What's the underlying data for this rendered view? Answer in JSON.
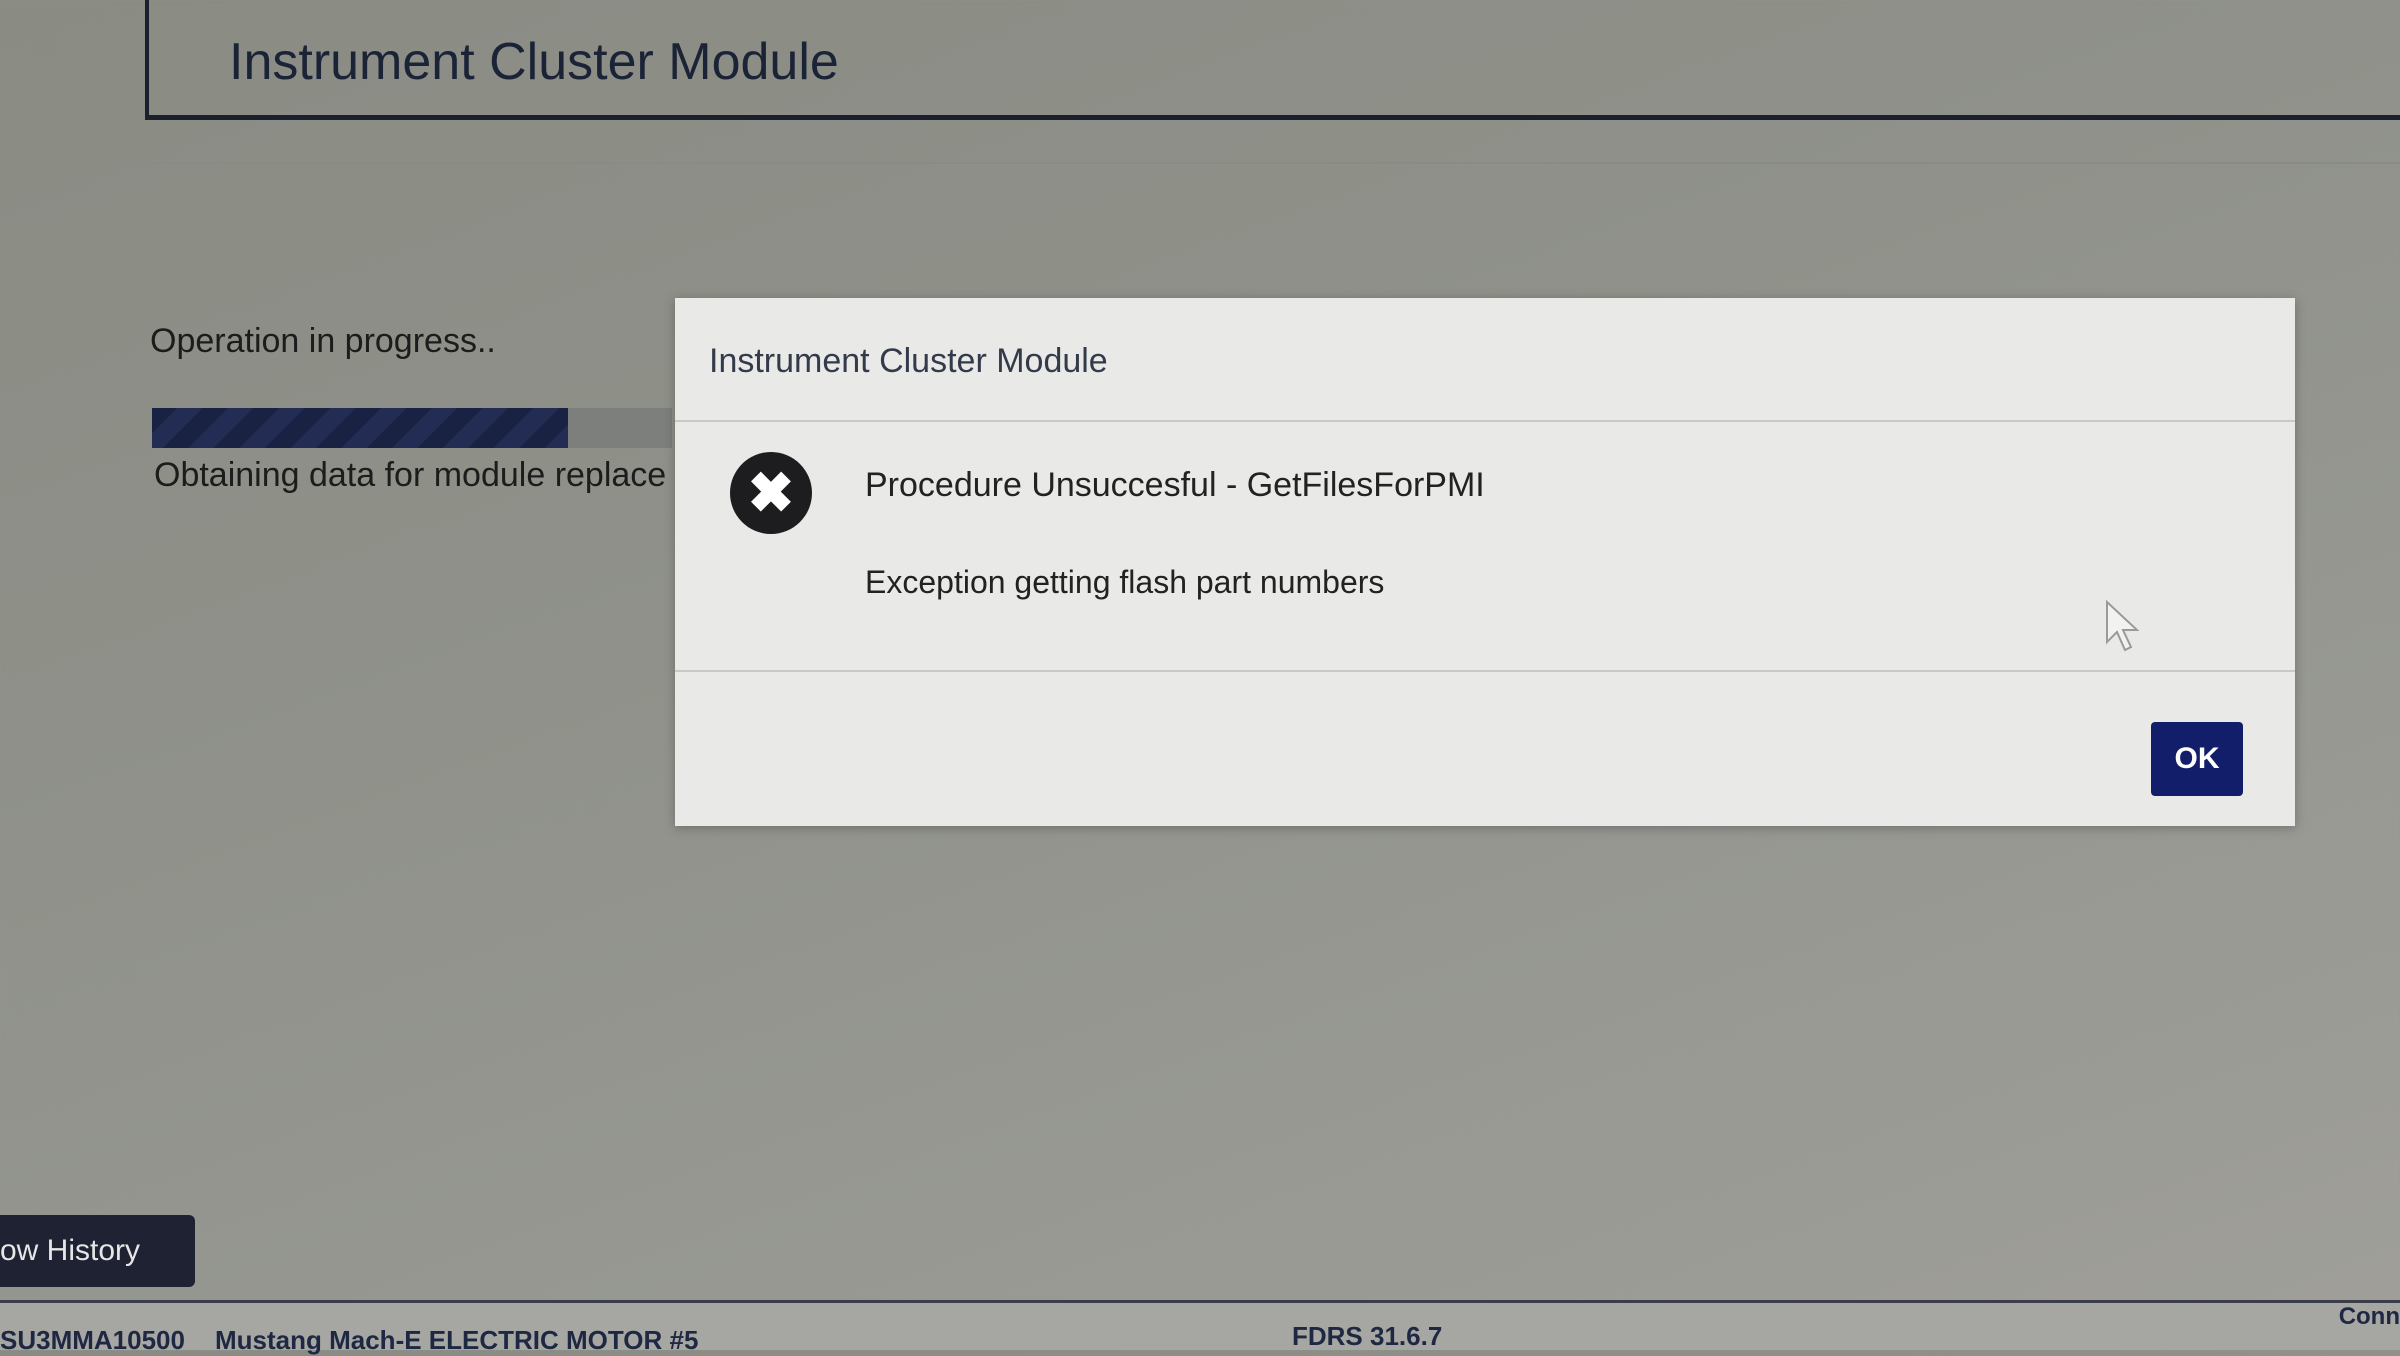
{
  "header": {
    "title": "Instrument Cluster Module"
  },
  "operation": {
    "status": "Operation in progress..",
    "progress": 0.8,
    "detail": "Obtaining data for module replace"
  },
  "dialog": {
    "title": "Instrument Cluster Module",
    "icon": "error-x-icon",
    "message_title": "Procedure Unsuccesful - GetFilesForPMI",
    "message_detail": "Exception getting flash part numbers",
    "ok_label": "OK"
  },
  "footer": {
    "history_button": "ow History",
    "vin": "SU3MMA10500",
    "vehicle": "Mustang Mach-E ELECTRIC MOTOR #5",
    "version": "FDRS 31.6.7",
    "connection": "Conn"
  },
  "colors": {
    "accent": "#131e6b",
    "progress": "#1a2244",
    "text_dark": "#1b2336"
  }
}
